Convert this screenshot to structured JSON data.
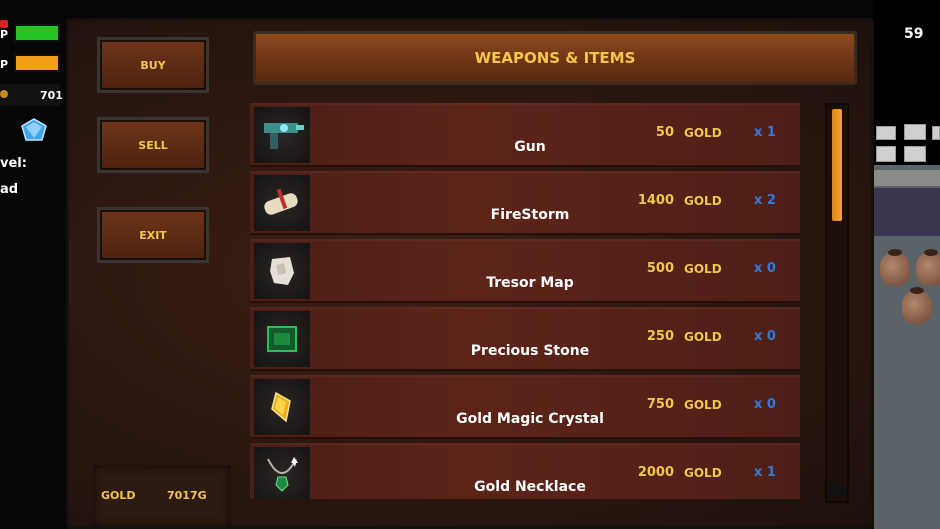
{
  "hud": {
    "hp_label": "P",
    "mp_label": "P",
    "hp_fill": 1.0,
    "mp_fill": 1.0,
    "gold_value": "701",
    "level_label": "vel:",
    "level_value": "ad",
    "colors": {
      "hp": "#23c423",
      "mp": "#f0a018"
    }
  },
  "fps": "59",
  "shop": {
    "buttons": {
      "buy": "BUY",
      "sell": "SELL",
      "exit": "EXIT"
    },
    "title": "WEAPONS & ITEMS",
    "gold_label": "GOLD",
    "gold_value": "7017G",
    "items": [
      {
        "name": "Gun",
        "price": "50",
        "unit": "GOLD",
        "qty": "x 1",
        "icon": "gun-icon"
      },
      {
        "name": "FireStorm",
        "price": "1400",
        "unit": "GOLD",
        "qty": "x 2",
        "icon": "scroll-icon"
      },
      {
        "name": "Tresor Map",
        "price": "500",
        "unit": "GOLD",
        "qty": "x 0",
        "icon": "map-icon"
      },
      {
        "name": "Precious Stone",
        "price": "250",
        "unit": "GOLD",
        "qty": "x 0",
        "icon": "emerald-icon"
      },
      {
        "name": "Gold Magic Crystal",
        "price": "750",
        "unit": "GOLD",
        "qty": "x 0",
        "icon": "crystal-icon"
      },
      {
        "name": "Gold Necklace",
        "price": "2000",
        "unit": "GOLD",
        "qty": "x 1",
        "icon": "necklace-icon"
      }
    ],
    "scroll_position": 0.0
  },
  "colors": {
    "gold_text": "#f1c84a",
    "qty_blue": "#2f7ce0",
    "panel": "#2a1610"
  }
}
